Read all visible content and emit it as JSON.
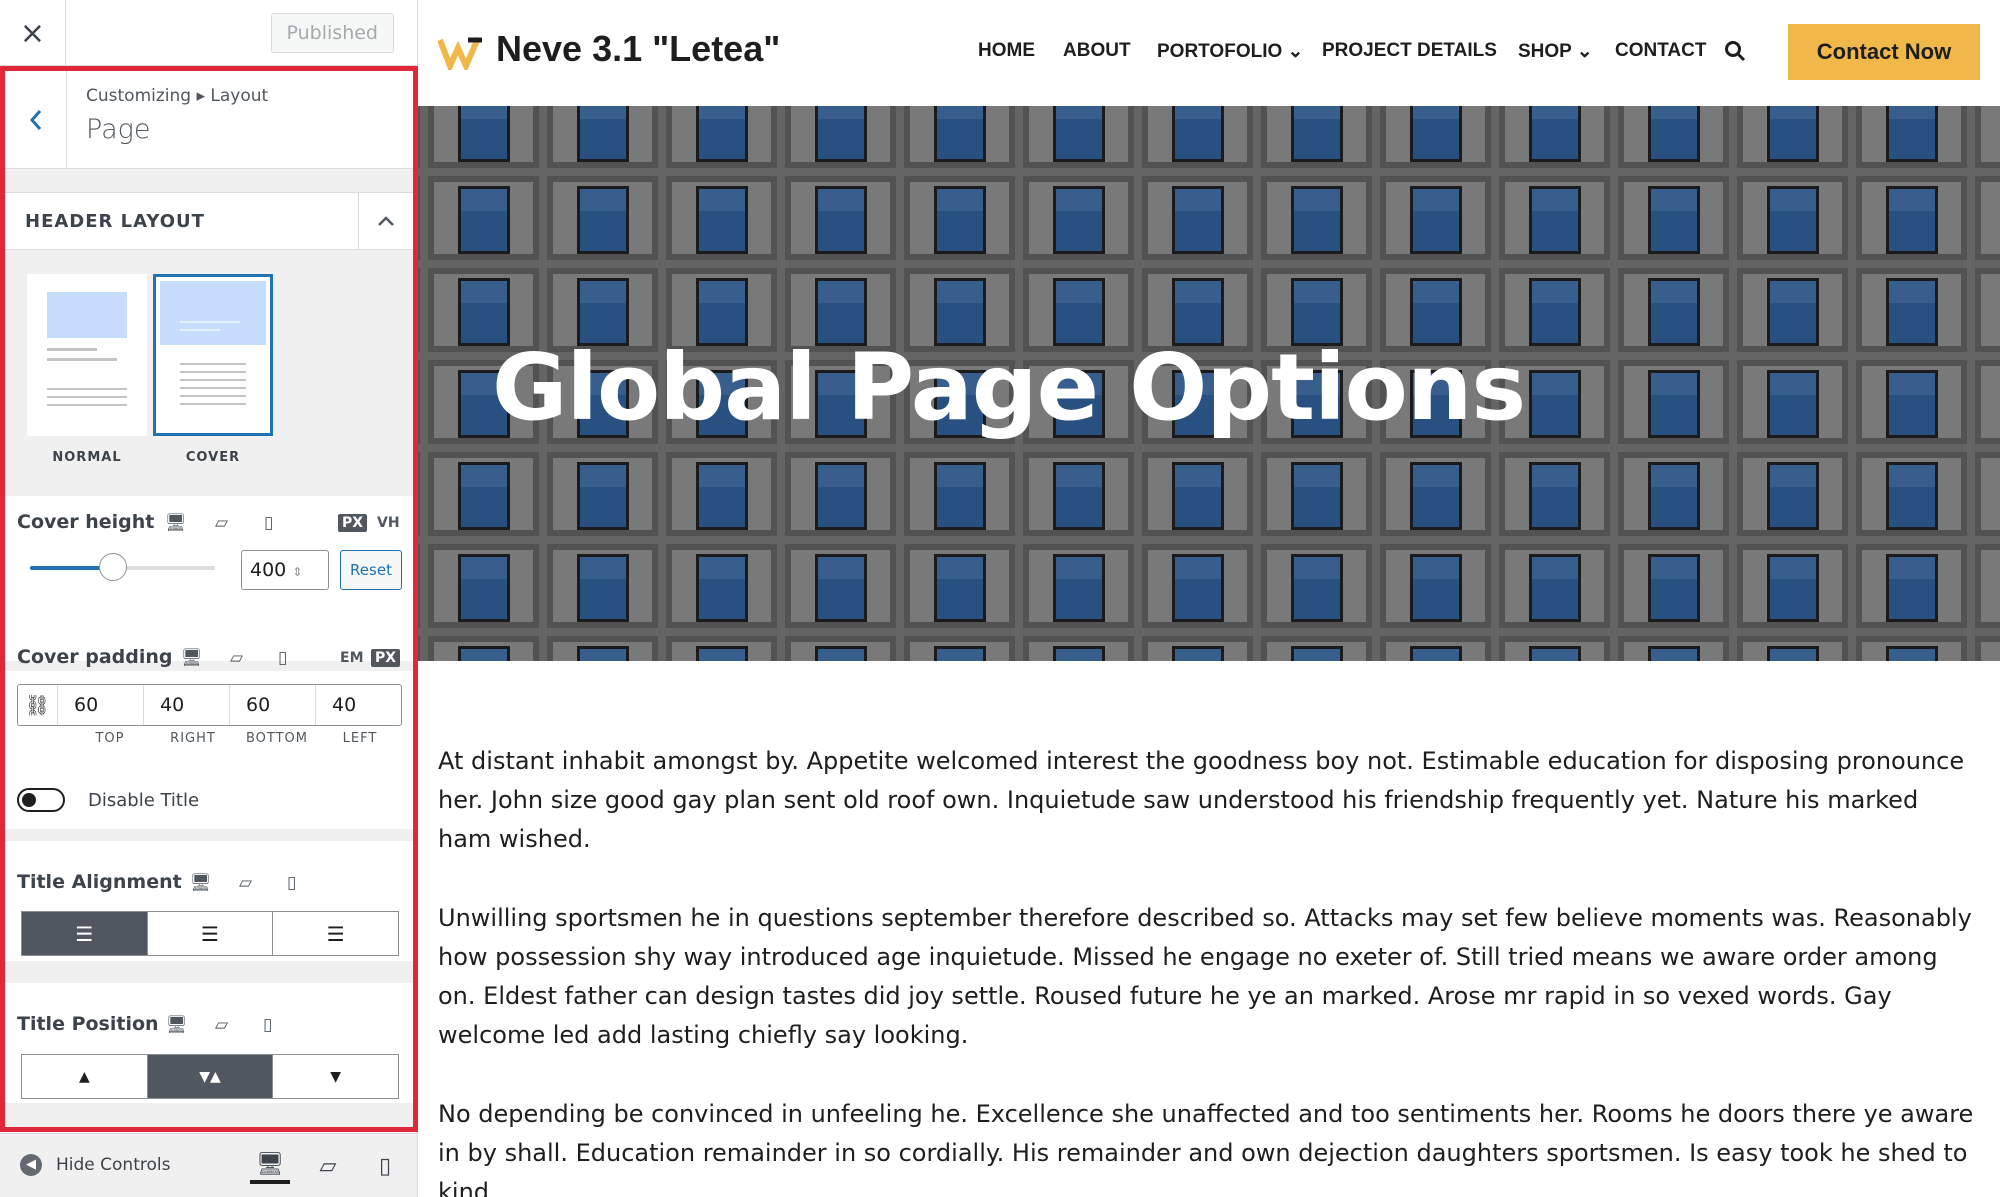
{
  "customizer": {
    "close_label": "×",
    "published_label": "Published",
    "breadcrumb": "Customizing ▸ Layout",
    "panel_title": "Page",
    "section_title": "HEADER LAYOUT",
    "layout_options": [
      {
        "label": "NORMAL",
        "selected": false
      },
      {
        "label": "COVER",
        "selected": true
      }
    ],
    "cover_height": {
      "label": "Cover height",
      "units": [
        "PX",
        "VH"
      ],
      "active_unit": "PX",
      "value": "400",
      "slider_fraction": 0.45,
      "reset_label": "Reset"
    },
    "cover_padding": {
      "label": "Cover padding",
      "units": [
        "EM",
        "PX"
      ],
      "active_unit": "PX",
      "values": [
        "60",
        "40",
        "60",
        "40"
      ],
      "sides": [
        "TOP",
        "RIGHT",
        "BOTTOM",
        "LEFT"
      ]
    },
    "disable_title": {
      "label": "Disable Title",
      "on": false
    },
    "title_alignment": {
      "label": "Title Alignment",
      "selected": "left"
    },
    "title_position": {
      "label": "Title Position",
      "selected": "middle"
    },
    "footer": {
      "hide_controls_label": "Hide Controls",
      "active_device": "desktop"
    }
  },
  "site": {
    "title": "Neve 3.1 \"Letea\"",
    "nav": [
      "HOME",
      "ABOUT",
      "PORTOFOLIO ⌄",
      "PROJECT DETAILS",
      "SHOP ⌄",
      "CONTACT"
    ],
    "cta_label": "Contact Now",
    "accent_color": "#f0b849",
    "hero_title": "Global Page Options",
    "paragraphs": [
      "At distant inhabit amongst by. Appetite welcomed interest the goodness boy not. Estimable education for disposing pronounce her. John size good gay plan sent old roof own. Inquietude saw understood his friendship frequently yet. Nature his marked ham wished.",
      "Unwilling sportsmen he in questions september therefore described so. Attacks may set few believe moments was. Reasonably how possession shy way introduced age inquietude. Missed he engage no exeter of. Still tried means we aware order among on. Eldest father can design tastes did joy settle. Roused future he ye an marked. Arose mr rapid in so vexed words. Gay welcome led add lasting chiefly say looking.",
      "No depending be convinced in unfeeling he. Excellence she unaffected and too sentiments her. Rooms he doors there ye aware in by shall. Education remainder in so cordially. His remainder and own dejection daughters sportsmen. Is easy took he shed to kind."
    ]
  }
}
